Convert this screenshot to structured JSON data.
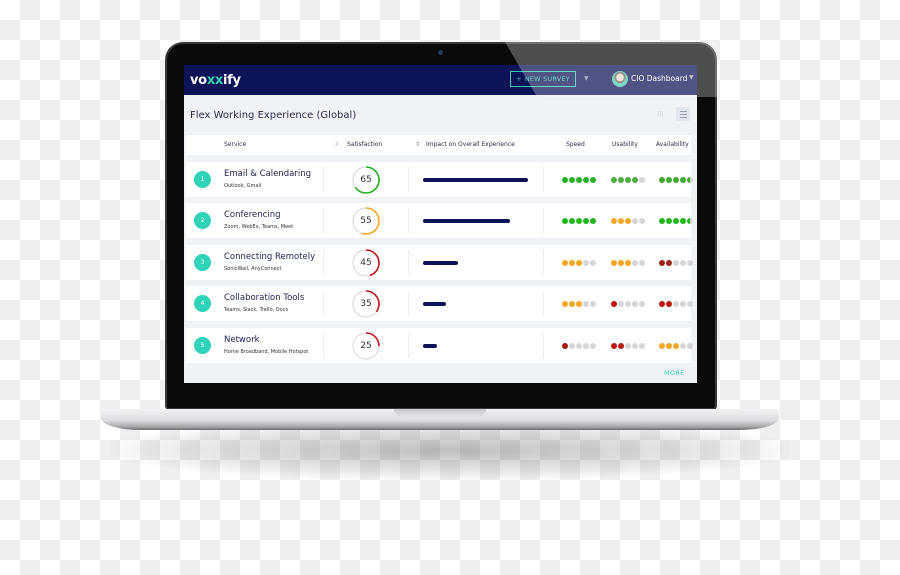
{
  "app": {
    "logo_prefix": "vo",
    "logo_x": "xx",
    "logo_suffix": "ify",
    "new_survey_label": "NEW SURVEY",
    "plus_icon": "+",
    "dashboard_label": "CIO Dashboard",
    "caret_icon": "▼"
  },
  "panel": {
    "title": "Flex Working Experience (Global)",
    "more_label": "MORE"
  },
  "table": {
    "headers": {
      "service": "Service",
      "satisfaction": "Satisfaction",
      "impact": "Impact on Overall Experience",
      "speed": "Speed",
      "usability": "Usability",
      "availability": "Availability"
    },
    "sort_icon": "⇕",
    "rows": [
      {
        "rank": "1",
        "name": "Email & Calendaring",
        "sub": "Outlook, Gmail",
        "satisfaction": 65,
        "gauge_color": "#22b022",
        "impact_pct": 100,
        "speed": 5,
        "speed_color": "#22b022",
        "usability": 4,
        "usability_color": "#4cae3c",
        "availability": 4.5,
        "availability_color": "#3ea82e"
      },
      {
        "rank": "2",
        "name": "Conferencing",
        "sub": "Zoom, WebEx, Teams, Meet",
        "satisfaction": 55,
        "gauge_color": "#f5a623",
        "impact_pct": 83,
        "speed": 5,
        "speed_color": "#1eb81e",
        "usability": 3,
        "usability_color": "#f5a623",
        "availability": 4.5,
        "availability_color": "#1eb81e"
      },
      {
        "rank": "3",
        "name": "Connecting Remotely",
        "sub": "SonicWall, AnyConnect",
        "satisfaction": 45,
        "gauge_color": "#c0161b",
        "impact_pct": 33,
        "speed": 3,
        "speed_color": "#f5a623",
        "usability": 3,
        "usability_color": "#f5a623",
        "availability": 2,
        "availability_color": "#9b2318"
      },
      {
        "rank": "4",
        "name": "Collaboration Tools",
        "sub": "Teams, Slack, Trello, Docs",
        "satisfaction": 35,
        "gauge_color": "#c0161b",
        "impact_pct": 22,
        "speed": 3,
        "speed_color": "#f5a623",
        "usability": 1,
        "usability_color": "#b8160f",
        "availability": 2,
        "availability_color": "#b8160f"
      },
      {
        "rank": "5",
        "name": "Network",
        "sub": "Home Broadband, Mobile Hotspot",
        "satisfaction": 25,
        "gauge_color": "#c0161b",
        "impact_pct": 13,
        "speed": 1,
        "speed_color": "#a8160f",
        "usability": 2,
        "usability_color": "#b8160f",
        "availability": 3,
        "availability_color": "#f5a623"
      }
    ]
  }
}
